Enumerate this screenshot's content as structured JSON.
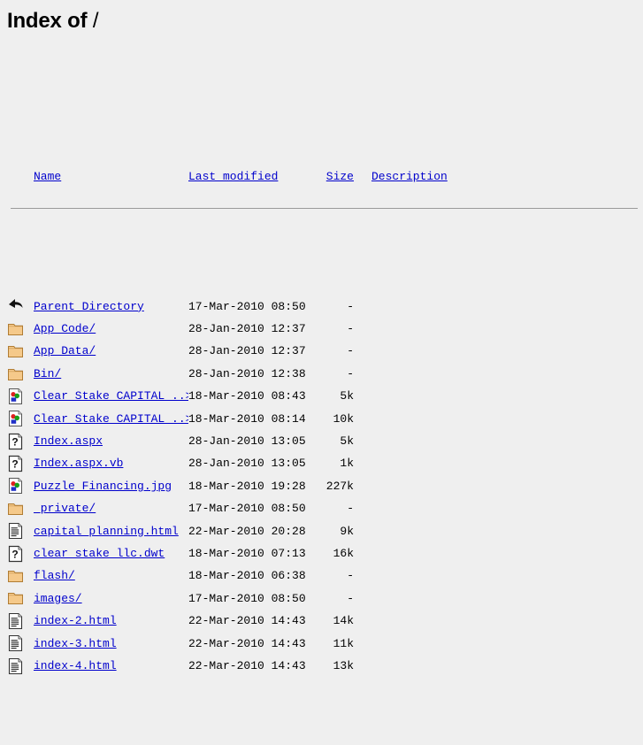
{
  "page": {
    "title_prefix": "Index of ",
    "title_path": "/"
  },
  "table": {
    "headers": {
      "name": "Name",
      "last_modified": "Last modified",
      "size": "Size",
      "description": "Description"
    },
    "rows": [
      {
        "icon": "back-arrow-icon",
        "name": "Parent Directory",
        "date": "17-Mar-2010 08:50",
        "size": "-",
        "description": ""
      },
      {
        "icon": "folder-icon",
        "name": "App_Code/",
        "date": "28-Jan-2010 12:37",
        "size": "-",
        "description": ""
      },
      {
        "icon": "folder-icon",
        "name": "App_Data/",
        "date": "28-Jan-2010 12:37",
        "size": "-",
        "description": ""
      },
      {
        "icon": "folder-icon",
        "name": "Bin/",
        "date": "28-Jan-2010 12:38",
        "size": "-",
        "description": ""
      },
      {
        "icon": "image-icon",
        "name": "Clear Stake CAPITAL ..>",
        "date": "18-Mar-2010 08:43",
        "size": "5k",
        "description": ""
      },
      {
        "icon": "image-icon",
        "name": "Clear Stake CAPITAL ..>",
        "date": "18-Mar-2010 08:14",
        "size": "10k",
        "description": ""
      },
      {
        "icon": "unknown-icon",
        "name": "Index.aspx",
        "date": "28-Jan-2010 13:05",
        "size": "5k",
        "description": ""
      },
      {
        "icon": "unknown-icon",
        "name": "Index.aspx.vb",
        "date": "28-Jan-2010 13:05",
        "size": "1k",
        "description": ""
      },
      {
        "icon": "image-icon",
        "name": "Puzzle Financing.jpg",
        "date": "18-Mar-2010 19:28",
        "size": "227k",
        "description": ""
      },
      {
        "icon": "folder-icon",
        "name": "_private/",
        "date": "17-Mar-2010 08:50",
        "size": "-",
        "description": ""
      },
      {
        "icon": "text-icon",
        "name": "capital_planning.html",
        "date": "22-Mar-2010 20:28",
        "size": "9k",
        "description": ""
      },
      {
        "icon": "unknown-icon",
        "name": "clear_stake_llc.dwt",
        "date": "18-Mar-2010 07:13",
        "size": "16k",
        "description": ""
      },
      {
        "icon": "folder-icon",
        "name": "flash/",
        "date": "18-Mar-2010 06:38",
        "size": "-",
        "description": ""
      },
      {
        "icon": "folder-icon",
        "name": "images/",
        "date": "17-Mar-2010 08:50",
        "size": "-",
        "description": ""
      },
      {
        "icon": "text-icon",
        "name": "index-2.html",
        "date": "22-Mar-2010 14:43",
        "size": "14k",
        "description": ""
      },
      {
        "icon": "text-icon",
        "name": "index-3.html",
        "date": "22-Mar-2010 14:43",
        "size": "11k",
        "description": ""
      },
      {
        "icon": "text-icon",
        "name": "index-4.html",
        "date": "22-Mar-2010 14:43",
        "size": "13k",
        "description": ""
      }
    ]
  },
  "colors": {
    "background": "#efefef",
    "link": "#0000cc",
    "text": "#000000",
    "rule": "#9a9a9a",
    "folder": "#f5c98a",
    "folder_edge": "#b07c33"
  }
}
